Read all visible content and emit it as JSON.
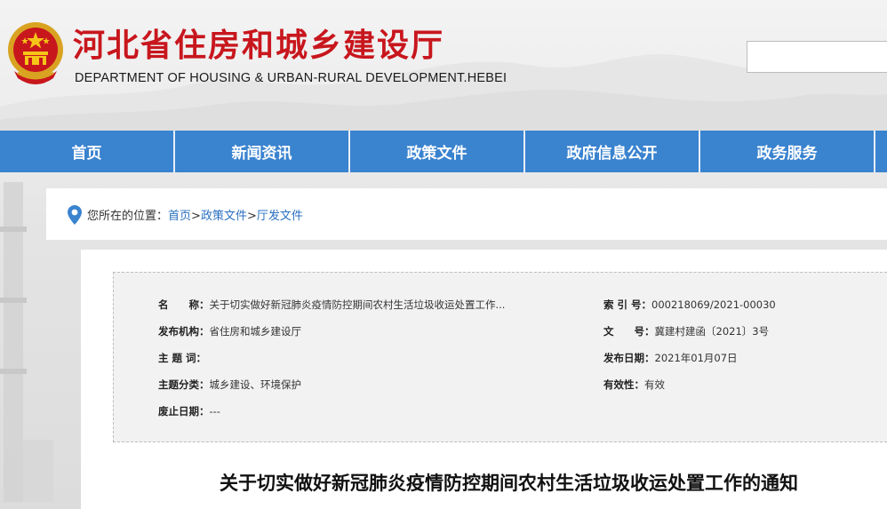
{
  "header": {
    "title": "河北省住房和城乡建设厅",
    "subtitle": "DEPARTMENT OF HOUSING & URBAN-RURAL DEVELOPMENT.HEBEI",
    "search_value": ""
  },
  "nav": {
    "items": [
      {
        "label": "首页"
      },
      {
        "label": "新闻资讯"
      },
      {
        "label": "政策文件"
      },
      {
        "label": "政府信息公开"
      },
      {
        "label": "政务服务"
      }
    ]
  },
  "breadcrumb": {
    "prefix": "您所在的位置：",
    "links": [
      "首页",
      "政策文件",
      "厅发文件"
    ],
    "separator": ">"
  },
  "meta": {
    "name_label": "名　　称：",
    "name_value": "关于切实做好新冠肺炎疫情防控期间农村生活垃圾收运处置工作...",
    "index_label": "索 引 号：",
    "index_value": "000218069/2021-00030",
    "publisher_label": "发布机构：",
    "publisher_value": "省住房和城乡建设厅",
    "docno_label": "文　　号：",
    "docno_value": "冀建村建函〔2021〕3号",
    "keywords_label": "主 题 词：",
    "keywords_value": "",
    "date_label": "发布日期：",
    "date_value": "2021年01月07日",
    "category_label": "主题分类：",
    "category_value": "城乡建设、环境保护",
    "validity_label": "有效性：",
    "validity_value": "有效",
    "expiry_label": "废止日期：",
    "expiry_value": "---"
  },
  "document": {
    "title": "关于切实做好新冠肺炎疫情防控期间农村生活垃圾收运处置工作的通知"
  },
  "colors": {
    "nav_blue": "#3a83cf",
    "title_red": "#c8161d",
    "link_blue": "#2a6fc0"
  }
}
